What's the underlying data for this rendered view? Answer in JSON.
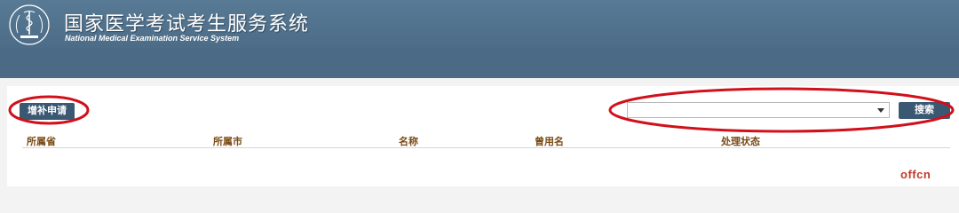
{
  "header": {
    "title_cn": "国家医学考试考生服务系统",
    "title_en": "National Medical Examination Service System",
    "logo_icon": "medical-caduceus-emblem"
  },
  "toolbar": {
    "add_label": "增补申请",
    "search_label": "搜索",
    "search_select_value": ""
  },
  "table": {
    "columns": [
      "所属省",
      "所属市",
      "名称",
      "曾用名",
      "处理状态"
    ]
  },
  "watermark": "offcn",
  "colors": {
    "header_bg": "#587a95",
    "nav_bg": "#4b6a85",
    "button_bg": "#3b5872",
    "column_text": "#7a4a14",
    "annotation": "#d0101a"
  }
}
